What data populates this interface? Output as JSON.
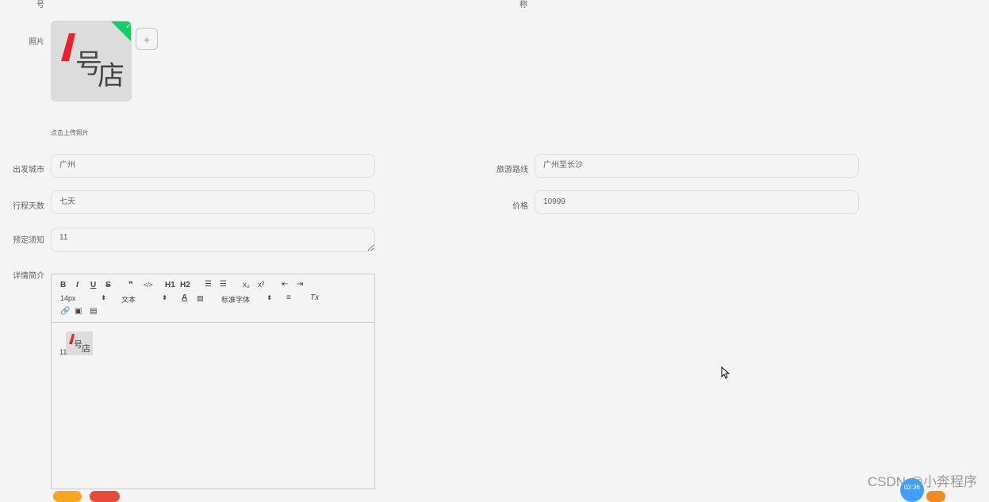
{
  "top_labels": {
    "left": "号",
    "right": "称"
  },
  "photo": {
    "label": "照片",
    "hint": "点击上传照片",
    "add_symbol": "+",
    "check_symbol": "✓",
    "logo_text": {
      "number": "1",
      "chars": "号店"
    }
  },
  "fields": {
    "departure_city": {
      "label": "出发城市",
      "value": "广州"
    },
    "travel_route": {
      "label": "旅游路线",
      "value": "广州至长沙"
    },
    "trip_days": {
      "label": "行程天数",
      "value": "七天"
    },
    "price": {
      "label": "价格",
      "value": "10999"
    },
    "booking_notes": {
      "label": "预定须知",
      "value": "11"
    }
  },
  "editor": {
    "label": "详情简介",
    "toolbar_row1": [
      "B",
      "I",
      "U",
      "S",
      "❞",
      "</>",
      "H1",
      "H2",
      "ol",
      "ul",
      "x₂",
      "x²",
      "⇤",
      "⇥"
    ],
    "size_select": "14px",
    "type_select": "文本",
    "font_select": "标准字体",
    "clear_format": "Tx",
    "content_text": "11"
  },
  "watermark": "CSDN @小奔程序",
  "timer": "02:36",
  "colors": {
    "bg": "#f4f4f4",
    "accent_green": "#13ce66",
    "timer_blue": "#409eff"
  }
}
